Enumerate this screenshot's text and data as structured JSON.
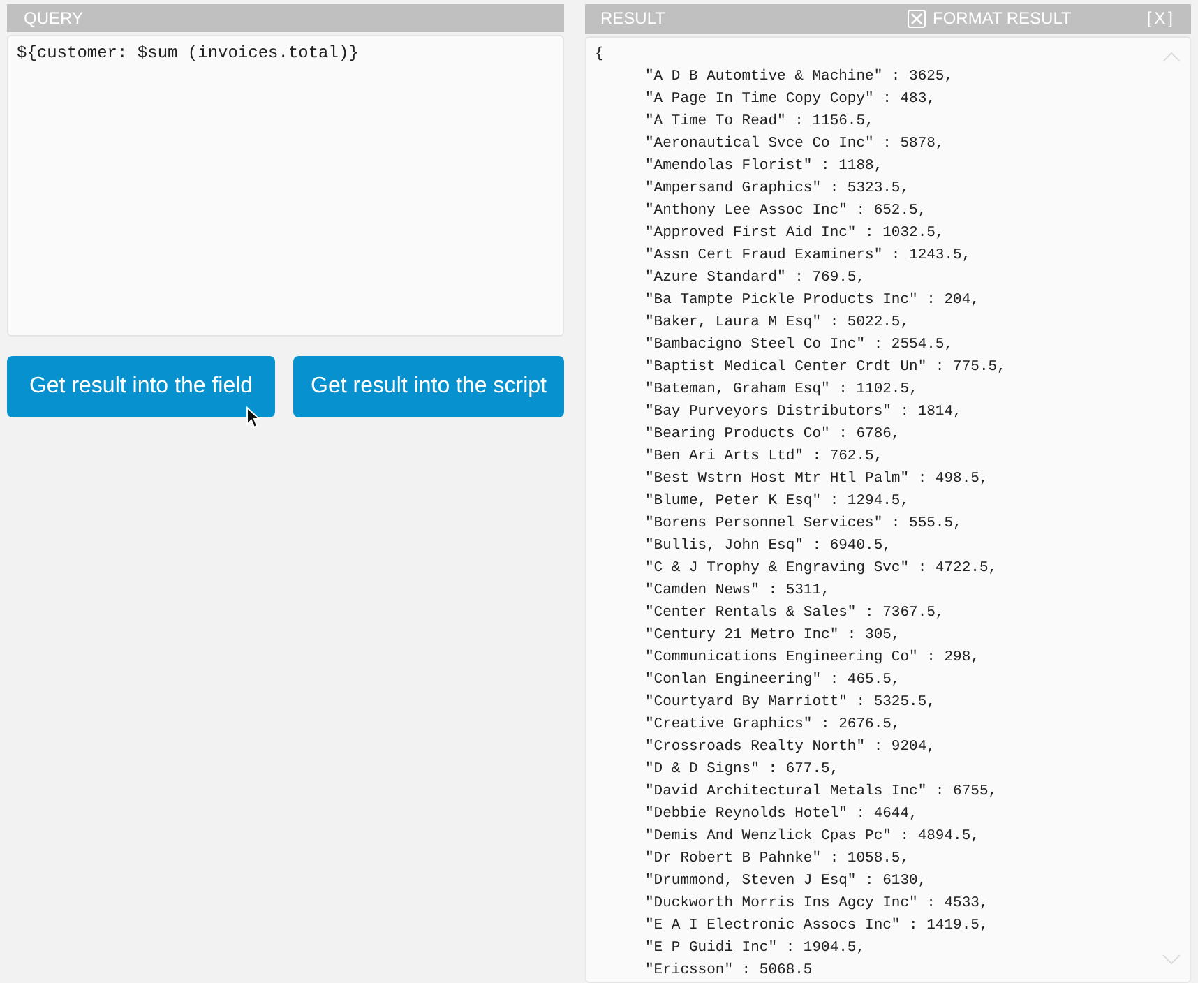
{
  "query": {
    "title": "QUERY",
    "value": "${customer: $sum (invoices.total)}"
  },
  "buttons": [
    "Get result into the field",
    "Get result into the script"
  ],
  "result": {
    "title": "RESULT",
    "format_result": {
      "label": "FORMAT RESULT",
      "checked": true
    },
    "close": "[X]",
    "open_brace": "{",
    "lines": [
      "\"A D B Automtive & Machine\" : 3625,",
      "\"A Page In Time Copy Copy\" : 483,",
      "\"A Time To Read\" : 1156.5,",
      "\"Aeronautical Svce Co Inc\" : 5878,",
      "\"Amendolas Florist\" : 1188,",
      "\"Ampersand Graphics\" : 5323.5,",
      "\"Anthony Lee Assoc Inc\" : 652.5,",
      "\"Approved First Aid Inc\" : 1032.5,",
      "\"Assn Cert Fraud Examiners\" : 1243.5,",
      "\"Azure Standard\" : 769.5,",
      "\"Ba Tampte Pickle Products Inc\" : 204,",
      "\"Baker, Laura M Esq\" : 5022.5,",
      "\"Bambacigno Steel Co Inc\" : 2554.5,",
      "\"Baptist Medical Center Crdt Un\" : 775.5,",
      "\"Bateman, Graham Esq\" : 1102.5,",
      "\"Bay Purveyors Distributors\" : 1814,",
      "\"Bearing Products Co\" : 6786,",
      "\"Ben Ari Arts Ltd\" : 762.5,",
      "\"Best Wstrn Host Mtr Htl Palm\" : 498.5,",
      "\"Blume, Peter K Esq\" : 1294.5,",
      "\"Borens Personnel Services\" : 555.5,",
      "\"Bullis, John Esq\" : 6940.5,",
      "\"C & J Trophy & Engraving Svc\" : 4722.5,",
      "\"Camden News\" : 5311,",
      "\"Center Rentals & Sales\" : 7367.5,",
      "\"Century 21 Metro Inc\" : 305,",
      "\"Communications Engineering Co\" : 298,",
      "\"Conlan Engineering\" : 465.5,",
      "\"Courtyard By Marriott\" : 5325.5,",
      "\"Creative Graphics\" : 2676.5,",
      "\"Crossroads Realty North\" : 9204,",
      "\"D & D Signs\" : 677.5,",
      "\"David Architectural Metals Inc\" : 6755,",
      "\"Debbie Reynolds Hotel\" : 4644,",
      "\"Demis And Wenzlick Cpas Pc\" : 4894.5,",
      "\"Dr Robert B Pahnke\" : 1058.5,",
      "\"Drummond, Steven J Esq\" : 6130,",
      "\"Duckworth Morris Ins Agcy Inc\" : 4533,",
      "\"E A I Electronic Assocs Inc\" : 1419.5,",
      "\"E P Guidi Inc\" : 1904.5,",
      "\"Ericsson\" : 5068.5"
    ]
  }
}
